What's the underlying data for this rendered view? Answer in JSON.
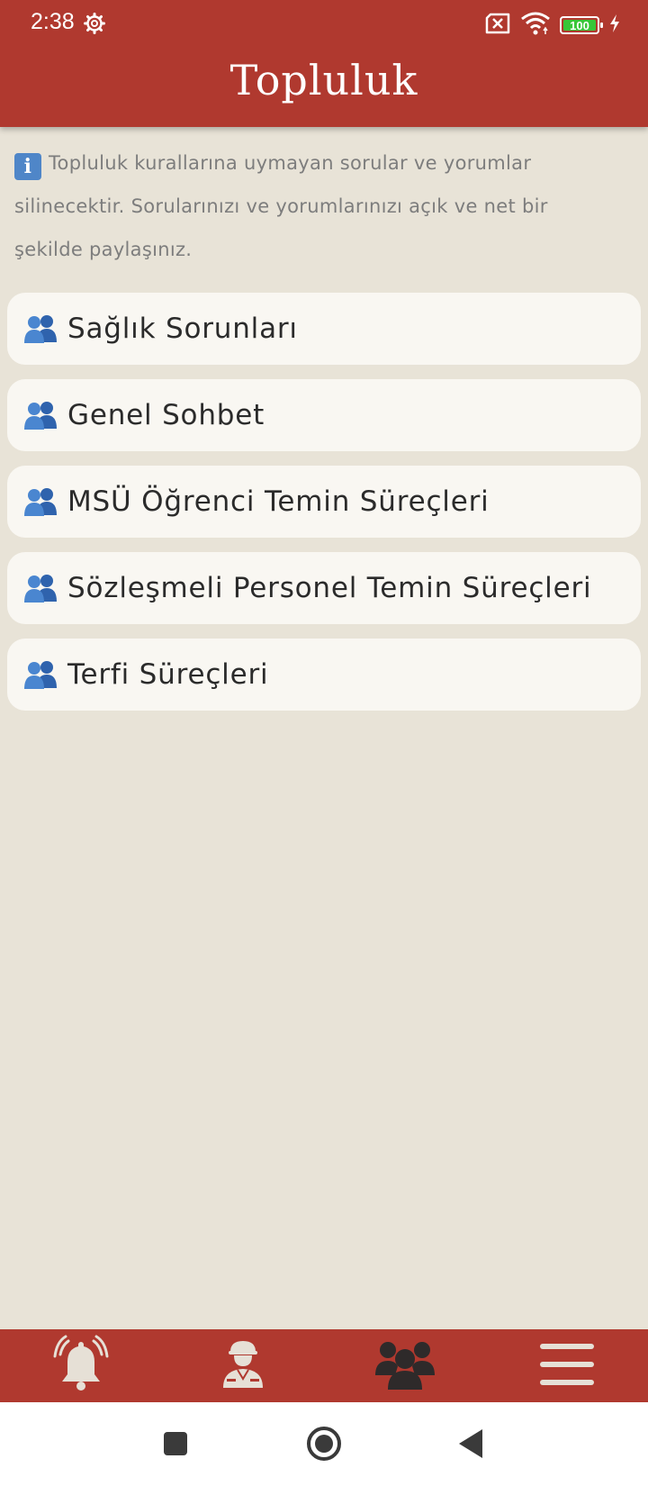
{
  "status_bar": {
    "time": "2:38",
    "battery": "100",
    "icons": [
      "settings-gear-icon",
      "no-sim-icon",
      "wifi-icon",
      "battery-icon",
      "charging-bolt-icon"
    ]
  },
  "app_bar": {
    "title": "Topluluk"
  },
  "notice": {
    "icon": "info-icon",
    "icon_glyph": "i",
    "text": "Topluluk kurallarına uymayan sorular ve yorumlar silinecektir. Sorularınızı ve yorumlarınızı açık ve net bir şekilde paylaşınız."
  },
  "groups": [
    {
      "label": "Sağlık Sorunları",
      "icon": "people-icon"
    },
    {
      "label": "Genel Sohbet",
      "icon": "people-icon"
    },
    {
      "label": "MSÜ Öğrenci Temin Süreçleri",
      "icon": "people-icon"
    },
    {
      "label": "Sözleşmeli Personel Temin Süreçleri",
      "icon": "people-icon"
    },
    {
      "label": "Terfi Süreçleri",
      "icon": "people-icon"
    }
  ],
  "bottom_nav": [
    {
      "icon": "bell-ringing-icon",
      "active": false
    },
    {
      "icon": "soldier-icon",
      "active": false
    },
    {
      "icon": "community-icon",
      "active": true
    },
    {
      "icon": "menu-icon",
      "active": false
    }
  ],
  "system_nav": [
    "recents-square-icon",
    "home-circle-icon",
    "back-triangle-icon"
  ],
  "colors": {
    "primary": "#b0392f",
    "background": "#e8e3d7",
    "card": "#f9f7f2",
    "nav_inactive": "#e6e0d6",
    "nav_active": "#2e2a2a",
    "info_blue": "#4f86c8",
    "people_blue": "#3a72c2"
  }
}
